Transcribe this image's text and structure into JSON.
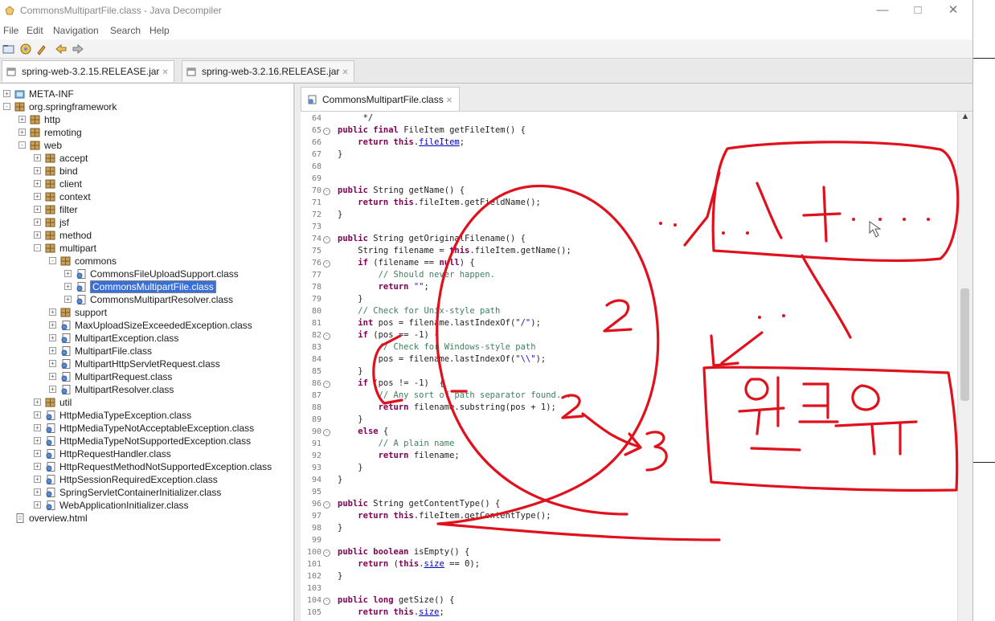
{
  "window": {
    "title": "CommonsMultipartFile.class - Java Decompiler"
  },
  "menu": [
    "File",
    "Edit",
    "Navigation",
    "Search",
    "Help"
  ],
  "toolbar_icons": [
    "open-file-icon",
    "open-type-icon",
    "search-icon",
    "back-icon",
    "forward-icon"
  ],
  "editor_tabs": [
    {
      "label": "spring-web-3.2.15.RELEASE.jar",
      "active": true
    },
    {
      "label": "spring-web-3.2.16.RELEASE.jar",
      "active": false
    }
  ],
  "tree": [
    {
      "label": "META-INF",
      "depth": 0,
      "icon": "folder",
      "toggle": "+"
    },
    {
      "label": "org.springframework",
      "depth": 0,
      "icon": "package",
      "toggle": "-"
    },
    {
      "label": "http",
      "depth": 1,
      "icon": "package",
      "toggle": "+"
    },
    {
      "label": "remoting",
      "depth": 1,
      "icon": "package",
      "toggle": "+"
    },
    {
      "label": "web",
      "depth": 1,
      "icon": "package",
      "toggle": "-"
    },
    {
      "label": "accept",
      "depth": 2,
      "icon": "package",
      "toggle": "+"
    },
    {
      "label": "bind",
      "depth": 2,
      "icon": "package",
      "toggle": "+"
    },
    {
      "label": "client",
      "depth": 2,
      "icon": "package",
      "toggle": "+"
    },
    {
      "label": "context",
      "depth": 2,
      "icon": "package",
      "toggle": "+"
    },
    {
      "label": "filter",
      "depth": 2,
      "icon": "package",
      "toggle": "+"
    },
    {
      "label": "jsf",
      "depth": 2,
      "icon": "package",
      "toggle": "+"
    },
    {
      "label": "method",
      "depth": 2,
      "icon": "package",
      "toggle": "+"
    },
    {
      "label": "multipart",
      "depth": 2,
      "icon": "package",
      "toggle": "-"
    },
    {
      "label": "commons",
      "depth": 3,
      "icon": "package",
      "toggle": "-"
    },
    {
      "label": "CommonsFileUploadSupport.class",
      "depth": 4,
      "icon": "class",
      "toggle": "+"
    },
    {
      "label": "CommonsMultipartFile.class",
      "depth": 4,
      "icon": "class",
      "toggle": "+",
      "selected": true
    },
    {
      "label": "CommonsMultipartResolver.class",
      "depth": 4,
      "icon": "class",
      "toggle": "+"
    },
    {
      "label": "support",
      "depth": 3,
      "icon": "package",
      "toggle": "+"
    },
    {
      "label": "MaxUploadSizeExceededException.class",
      "depth": 3,
      "icon": "class",
      "toggle": "+"
    },
    {
      "label": "MultipartException.class",
      "depth": 3,
      "icon": "class",
      "toggle": "+"
    },
    {
      "label": "MultipartFile.class",
      "depth": 3,
      "icon": "class",
      "toggle": "+"
    },
    {
      "label": "MultipartHttpServletRequest.class",
      "depth": 3,
      "icon": "class",
      "toggle": "+"
    },
    {
      "label": "MultipartRequest.class",
      "depth": 3,
      "icon": "class",
      "toggle": "+"
    },
    {
      "label": "MultipartResolver.class",
      "depth": 3,
      "icon": "class",
      "toggle": "+"
    },
    {
      "label": "util",
      "depth": 2,
      "icon": "package",
      "toggle": "+"
    },
    {
      "label": "HttpMediaTypeException.class",
      "depth": 2,
      "icon": "class",
      "toggle": "+"
    },
    {
      "label": "HttpMediaTypeNotAcceptableException.class",
      "depth": 2,
      "icon": "class",
      "toggle": "+"
    },
    {
      "label": "HttpMediaTypeNotSupportedException.class",
      "depth": 2,
      "icon": "class",
      "toggle": "+"
    },
    {
      "label": "HttpRequestHandler.class",
      "depth": 2,
      "icon": "class",
      "toggle": "+"
    },
    {
      "label": "HttpRequestMethodNotSupportedException.class",
      "depth": 2,
      "icon": "class",
      "toggle": "+"
    },
    {
      "label": "HttpSessionRequiredException.class",
      "depth": 2,
      "icon": "class",
      "toggle": "+"
    },
    {
      "label": "SpringServletContainerInitializer.class",
      "depth": 2,
      "icon": "class",
      "toggle": "+"
    },
    {
      "label": "WebApplicationInitializer.class",
      "depth": 2,
      "icon": "class",
      "toggle": "+"
    },
    {
      "label": "overview.html",
      "depth": 0,
      "icon": "file",
      "toggle": ""
    }
  ],
  "code_tab": {
    "label": "CommonsMultipartFile.class"
  },
  "code_lines": [
    {
      "no": "64",
      "fold": false,
      "tokens": [
        [
          "",
          "     */"
        ]
      ]
    },
    {
      "no": "65",
      "fold": true,
      "tokens": [
        [
          "kw",
          "public final "
        ],
        [
          "",
          "FileItem getFileItem() {"
        ]
      ]
    },
    {
      "no": "66",
      "fold": false,
      "tokens": [
        [
          "",
          "    "
        ],
        [
          "kw",
          "return this"
        ],
        [
          "",
          "."
        ],
        [
          "fd",
          "fileItem"
        ],
        [
          "",
          ";"
        ]
      ]
    },
    {
      "no": "67",
      "fold": false,
      "tokens": [
        [
          "",
          "}"
        ]
      ]
    },
    {
      "no": "68",
      "fold": false,
      "tokens": []
    },
    {
      "no": "69",
      "fold": false,
      "tokens": []
    },
    {
      "no": "70",
      "fold": true,
      "tokens": [
        [
          "kw",
          "public "
        ],
        [
          "",
          "String getName() {"
        ]
      ]
    },
    {
      "no": "71",
      "fold": false,
      "tokens": [
        [
          "",
          "    "
        ],
        [
          "kw",
          "return this"
        ],
        [
          "",
          ".fileItem.getFieldName();"
        ]
      ]
    },
    {
      "no": "72",
      "fold": false,
      "tokens": [
        [
          "",
          "}"
        ]
      ]
    },
    {
      "no": "73",
      "fold": false,
      "tokens": []
    },
    {
      "no": "74",
      "fold": true,
      "tokens": [
        [
          "kw",
          "public "
        ],
        [
          "",
          "String getOriginalFilename() {"
        ]
      ]
    },
    {
      "no": "75",
      "fold": false,
      "tokens": [
        [
          "",
          "    String filename = "
        ],
        [
          "kw",
          "this"
        ],
        [
          "",
          ".fileItem.getName();"
        ]
      ]
    },
    {
      "no": "76",
      "fold": true,
      "tokens": [
        [
          "",
          "    "
        ],
        [
          "kw",
          "if "
        ],
        [
          "",
          "(filename == "
        ],
        [
          "kw",
          "null"
        ],
        [
          "",
          ") {"
        ]
      ]
    },
    {
      "no": "77",
      "fold": false,
      "tokens": [
        [
          "",
          "        "
        ],
        [
          "cm",
          "// Should never happen."
        ]
      ]
    },
    {
      "no": "78",
      "fold": false,
      "tokens": [
        [
          "",
          "        "
        ],
        [
          "kw",
          "return "
        ],
        [
          "st",
          "\"\""
        ],
        [
          "",
          ";"
        ]
      ]
    },
    {
      "no": "79",
      "fold": false,
      "tokens": [
        [
          "",
          "    }"
        ]
      ]
    },
    {
      "no": "80",
      "fold": false,
      "tokens": [
        [
          "",
          "    "
        ],
        [
          "cm",
          "// Check for Unix-style path"
        ]
      ]
    },
    {
      "no": "81",
      "fold": false,
      "tokens": [
        [
          "",
          "    "
        ],
        [
          "kw",
          "int "
        ],
        [
          "",
          "pos = filename.lastIndexOf("
        ],
        [
          "st",
          "\"/\""
        ],
        [
          "",
          ");"
        ]
      ]
    },
    {
      "no": "82",
      "fold": true,
      "tokens": [
        [
          "",
          "    "
        ],
        [
          "kw",
          "if "
        ],
        [
          "",
          "(pos == -1) {"
        ]
      ]
    },
    {
      "no": "83",
      "fold": false,
      "tokens": [
        [
          "",
          "        "
        ],
        [
          "cm",
          "// Check for Windows-style path"
        ]
      ]
    },
    {
      "no": "84",
      "fold": false,
      "tokens": [
        [
          "",
          "        pos = filename.lastIndexOf("
        ],
        [
          "st",
          "\"\\\\\""
        ],
        [
          "",
          ");"
        ]
      ]
    },
    {
      "no": "85",
      "fold": false,
      "tokens": [
        [
          "",
          "    }"
        ]
      ]
    },
    {
      "no": "86",
      "fold": true,
      "tokens": [
        [
          "",
          "    "
        ],
        [
          "kw",
          "if "
        ],
        [
          "",
          "(pos != -1)  {"
        ]
      ]
    },
    {
      "no": "87",
      "fold": false,
      "tokens": [
        [
          "",
          "        "
        ],
        [
          "cm",
          "// Any sort of path separator found..."
        ]
      ]
    },
    {
      "no": "88",
      "fold": false,
      "tokens": [
        [
          "",
          "        "
        ],
        [
          "kw",
          "return "
        ],
        [
          "",
          "filename.substring(pos + 1);"
        ]
      ]
    },
    {
      "no": "89",
      "fold": false,
      "tokens": [
        [
          "",
          "    }"
        ]
      ]
    },
    {
      "no": "90",
      "fold": true,
      "tokens": [
        [
          "",
          "    "
        ],
        [
          "kw",
          "else "
        ],
        [
          "",
          "{"
        ]
      ]
    },
    {
      "no": "91",
      "fold": false,
      "tokens": [
        [
          "",
          "        "
        ],
        [
          "cm",
          "// A plain name"
        ]
      ]
    },
    {
      "no": "92",
      "fold": false,
      "tokens": [
        [
          "",
          "        "
        ],
        [
          "kw",
          "return "
        ],
        [
          "",
          "filename;"
        ]
      ]
    },
    {
      "no": "93",
      "fold": false,
      "tokens": [
        [
          "",
          "    }"
        ]
      ]
    },
    {
      "no": "94",
      "fold": false,
      "tokens": [
        [
          "",
          "}"
        ]
      ]
    },
    {
      "no": "95",
      "fold": false,
      "tokens": []
    },
    {
      "no": "96",
      "fold": true,
      "tokens": [
        [
          "kw",
          "public "
        ],
        [
          "",
          "String getContentType() {"
        ]
      ]
    },
    {
      "no": "97",
      "fold": false,
      "tokens": [
        [
          "",
          "    "
        ],
        [
          "kw",
          "return this"
        ],
        [
          "",
          ".fileItem.getContentType();"
        ]
      ]
    },
    {
      "no": "98",
      "fold": false,
      "tokens": [
        [
          "",
          "}"
        ]
      ]
    },
    {
      "no": "99",
      "fold": false,
      "tokens": []
    },
    {
      "no": "100",
      "fold": true,
      "tokens": [
        [
          "kw",
          "public boolean "
        ],
        [
          "",
          "isEmpty() {"
        ]
      ]
    },
    {
      "no": "101",
      "fold": false,
      "tokens": [
        [
          "",
          "    "
        ],
        [
          "kw",
          "return "
        ],
        [
          "",
          "("
        ],
        [
          "kw",
          "this"
        ],
        [
          "",
          "."
        ],
        [
          "fd",
          "size"
        ],
        [
          "",
          " == 0);"
        ]
      ]
    },
    {
      "no": "102",
      "fold": false,
      "tokens": [
        [
          "",
          "}"
        ]
      ]
    },
    {
      "no": "103",
      "fold": false,
      "tokens": []
    },
    {
      "no": "104",
      "fold": true,
      "tokens": [
        [
          "kw",
          "public long "
        ],
        [
          "",
          "getSize() {"
        ]
      ]
    },
    {
      "no": "105",
      "fold": false,
      "tokens": [
        [
          "",
          "    "
        ],
        [
          "kw",
          "return this"
        ],
        [
          "",
          "."
        ],
        [
          "fd",
          "size"
        ],
        [
          "",
          ";"
        ]
      ]
    }
  ],
  "annotation": {
    "color": "#e0101c",
    "numbers": [
      "2",
      "2",
      "3"
    ],
    "korean": "윈도우"
  },
  "colors": {
    "keyword": "#7f0055",
    "comment": "#3f7f5f",
    "string": "#2a00ff",
    "field": "#0000c0",
    "selection": "#3a6fd8"
  }
}
